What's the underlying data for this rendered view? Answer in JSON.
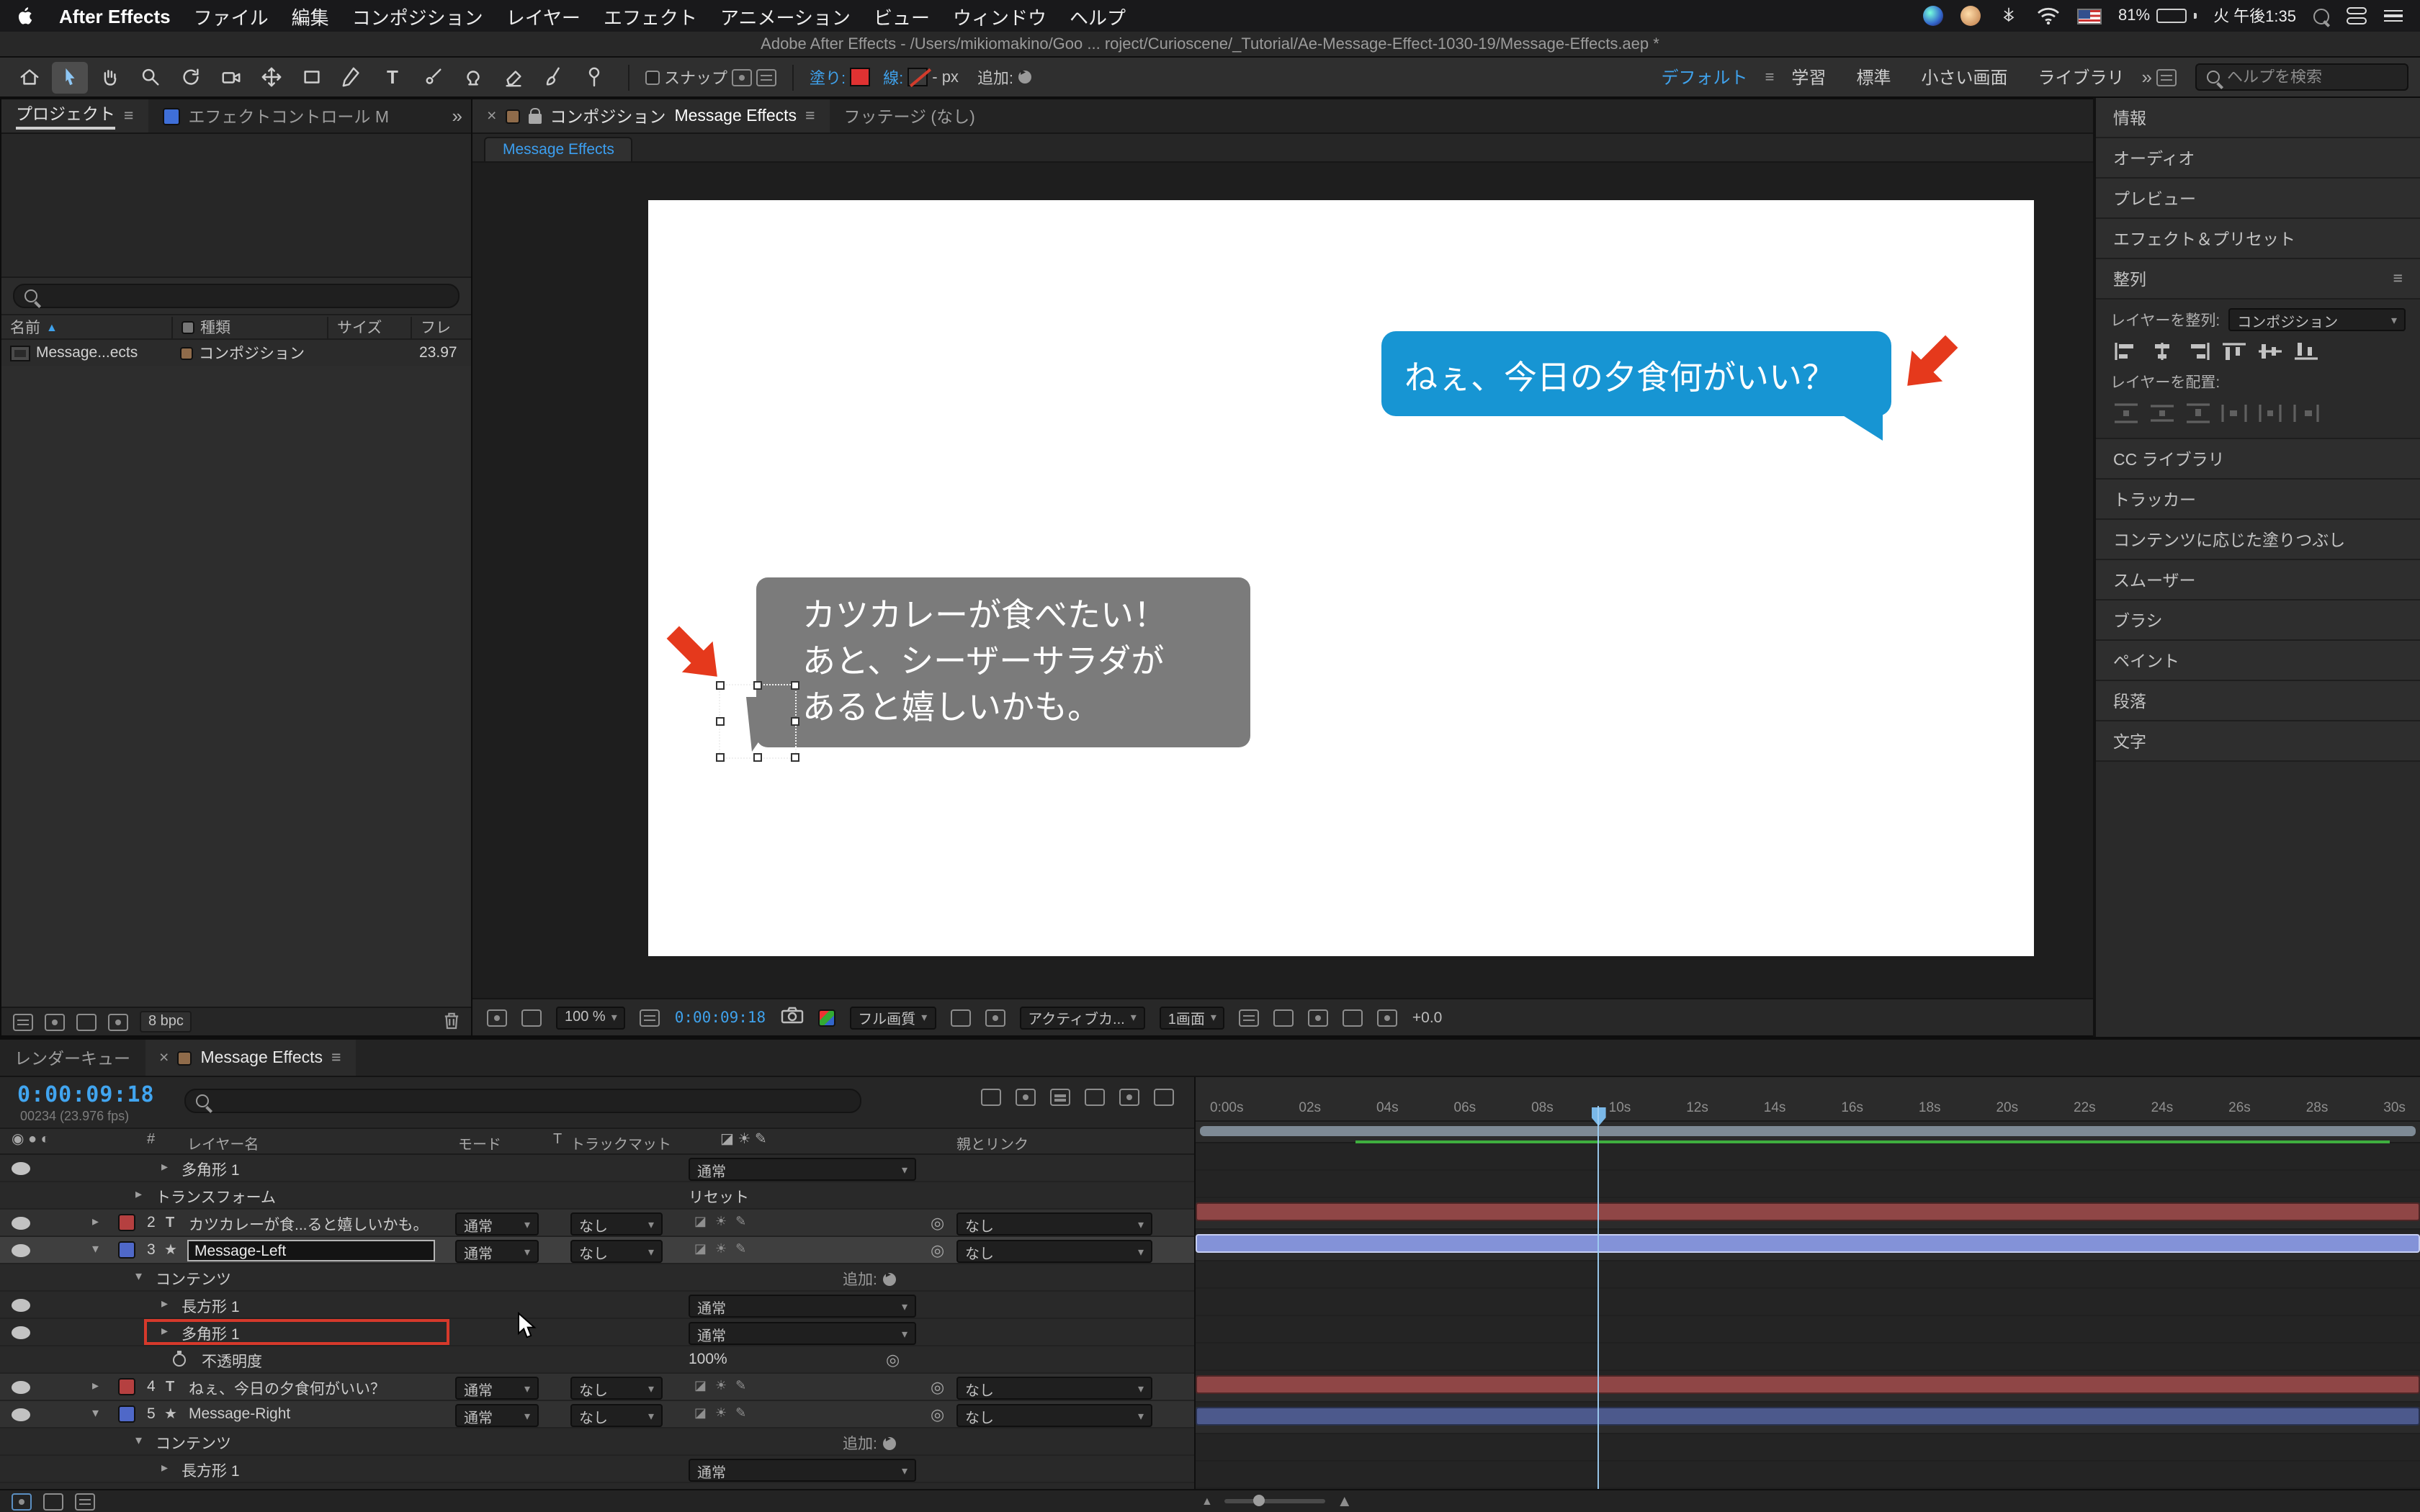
{
  "colors": {
    "accent_blue": "#3fa2ec",
    "bubble_blue": "#1795d3",
    "bubble_gray": "#7b7b7b",
    "arrow_red": "#e5391c",
    "fill_red": "#e03232",
    "bar_text": "#8f4646",
    "bar_shape": "#4c598c",
    "bar_shape_selected": "#8392d8",
    "workarea_green": "#3fae3f",
    "highlight_red": "#d6392b"
  },
  "icons": {
    "twirl_open": "▾",
    "twirl_closed": "▸",
    "dropdown_caret": "▾",
    "panel_menu": "≡",
    "close": "×",
    "text_layer": "T",
    "shape_layer": "★",
    "pickwhip": "◎",
    "sort_ascending": "▲",
    "overflow_chevrons": "»"
  },
  "menubar": {
    "app": "After Effects",
    "menus": [
      "ファイル",
      "編集",
      "コンポジション",
      "レイヤー",
      "エフェクト",
      "アニメーション",
      "ビュー",
      "ウィンドウ",
      "ヘルプ"
    ],
    "battery": "81%",
    "clock": "火 午後1:35"
  },
  "titlebar": {
    "title": "Adobe After Effects - /Users/mikiomakino/Goo ... roject/Curioscene/_Tutorial/Ae-Message-Effect-1030-19/Message-Effects.aep *"
  },
  "toolbar": {
    "snap": "スナップ",
    "fill_label": "塗り:",
    "stroke_label": "線:",
    "stroke_px": "- px",
    "add_label": "追加:",
    "workspace_active": "デフォルト",
    "workspaces": [
      "学習",
      "標準",
      "小さい画面",
      "ライブラリ"
    ],
    "help_search_placeholder": "ヘルプを検索"
  },
  "project": {
    "tab_project": "プロジェクト",
    "tab_effects": "エフェクトコントロール M",
    "columns": {
      "name": "名前",
      "type": "種類",
      "size": "サイズ",
      "fps": "フレ"
    },
    "item": {
      "name": "Message...ects",
      "type": "コンポジション",
      "fps": "23.97"
    },
    "bpc": "8 bpc"
  },
  "comp": {
    "tab_label": "コンポジション",
    "tab_name": "Message Effects",
    "tab_footage": "フッテージ (なし)",
    "viewer_tab": "Message Effects",
    "bubble_right_text": "ねぇ、今日の夕食何がいい？",
    "bubble_left_lines": [
      "カツカレーが食べたい！",
      "あと、シーザーサラダが",
      "あると嬉しいかも。"
    ],
    "status": {
      "zoom": "100 %",
      "timecode": "0:00:09:18",
      "quality": "フル画質",
      "camera": "アクティブカ...",
      "layout": "1画面",
      "exposure": "+0.0"
    }
  },
  "rightpanel": {
    "panels_top": [
      "情報",
      "オーディオ",
      "プレビュー",
      "エフェクト＆プリセット"
    ],
    "align": {
      "title": "整列",
      "align_label": "レイヤーを整列:",
      "align_value": "コンポジション",
      "place_label": "レイヤーを配置:"
    },
    "panels_bottom": [
      "CC ライブラリ",
      "トラッカー",
      "コンテンツに応じた塗りつぶし",
      "スムーザー",
      "ブラシ",
      "ペイント",
      "段落",
      "文字"
    ]
  },
  "timeline": {
    "tab_render_queue": "レンダーキュー",
    "tab_comp": "Message Effects",
    "timecode": "0:00:09:18",
    "frame_info": "00234 (23.976 fps)",
    "add_label": "追加:",
    "headers": {
      "number": "#",
      "name": "レイヤー名",
      "mode": "モード",
      "t": "T",
      "matte": "トラックマット",
      "parent": "親とリンク"
    },
    "ruler": [
      "0:00s",
      "02s",
      "04s",
      "06s",
      "08s",
      "10s",
      "12s",
      "14s",
      "16s",
      "18s",
      "20s",
      "22s",
      "24s",
      "26s",
      "28s",
      "30s"
    ],
    "rows": [
      {
        "name": "多角形 1",
        "mode": "通常"
      },
      {
        "name": "トランスフォーム",
        "value": "リセット"
      },
      {
        "num": "2",
        "name": "カツカレーが食...ると嬉しいかも。",
        "mode": "通常",
        "matte": "なし",
        "parent": "なし"
      },
      {
        "num": "3",
        "name": "Message-Left",
        "mode": "通常",
        "matte": "なし",
        "parent": "なし"
      },
      {
        "name": "コンテンツ"
      },
      {
        "name": "長方形 1",
        "mode": "通常"
      },
      {
        "name": "多角形 1",
        "mode": "通常"
      },
      {
        "name": "不透明度",
        "value": "100%"
      },
      {
        "num": "4",
        "name": "ねぇ、今日の夕食何がいい？",
        "mode": "通常",
        "matte": "なし",
        "parent": "なし"
      },
      {
        "num": "5",
        "name": "Message-Right",
        "mode": "通常",
        "matte": "なし",
        "parent": "なし"
      },
      {
        "name": "コンテンツ"
      },
      {
        "name": "長方形 1",
        "mode": "通常"
      }
    ]
  }
}
